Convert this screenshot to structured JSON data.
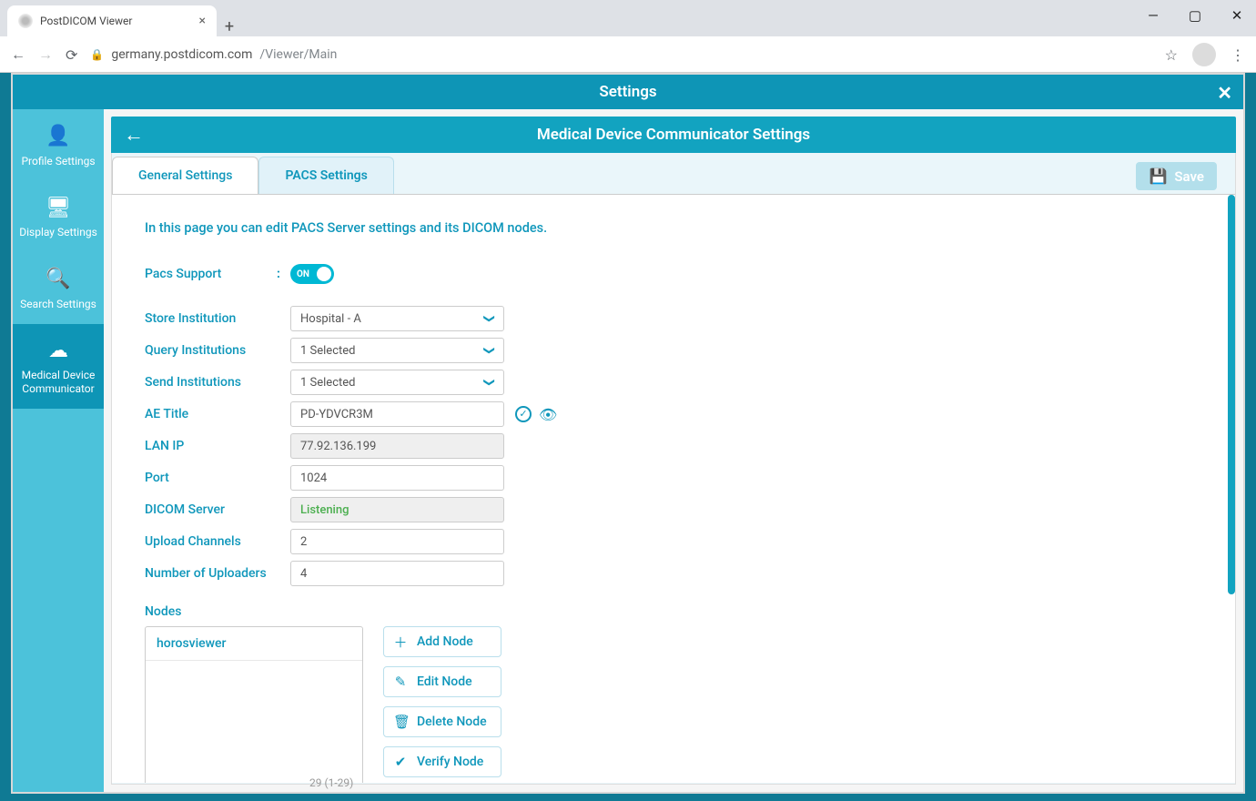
{
  "browser": {
    "tab_title": "PostDICOM Viewer",
    "url_host": "germany.postdicom.com",
    "url_path": "/Viewer/Main"
  },
  "modal": {
    "title": "Settings",
    "panel_title": "Medical Device Communicator Settings",
    "save_label": "Save"
  },
  "sidebar": {
    "items": [
      {
        "label": "Profile Settings"
      },
      {
        "label": "Display Settings"
      },
      {
        "label": "Search Settings"
      },
      {
        "label": "Medical Device Communicator"
      }
    ]
  },
  "tabs": {
    "general": "General Settings",
    "pacs": "PACS Settings"
  },
  "form": {
    "intro": "In this page you can edit PACS Server settings and its DICOM nodes.",
    "pacs_support_label": "Pacs Support",
    "pacs_support_toggle": "ON",
    "store_institution_label": "Store Institution",
    "store_institution_value": "Hospital - A",
    "query_institutions_label": "Query Institutions",
    "query_institutions_value": "1 Selected",
    "send_institutions_label": "Send Institutions",
    "send_institutions_value": "1 Selected",
    "ae_title_label": "AE Title",
    "ae_title_value": "PD-YDVCR3M",
    "lan_ip_label": "LAN IP",
    "lan_ip_value": "77.92.136.199",
    "port_label": "Port",
    "port_value": "1024",
    "dicom_server_label": "DICOM Server",
    "dicom_server_value": "Listening",
    "upload_channels_label": "Upload Channels",
    "upload_channels_value": "2",
    "num_uploaders_label": "Number of Uploaders",
    "num_uploaders_value": "4",
    "nodes_label": "Nodes",
    "nodes": [
      {
        "name": "horosviewer"
      }
    ],
    "node_buttons": {
      "add": "Add Node",
      "edit": "Edit Node",
      "delete": "Delete Node",
      "verify": "Verify Node"
    }
  },
  "bottom_obscured": "29 (1-29)"
}
